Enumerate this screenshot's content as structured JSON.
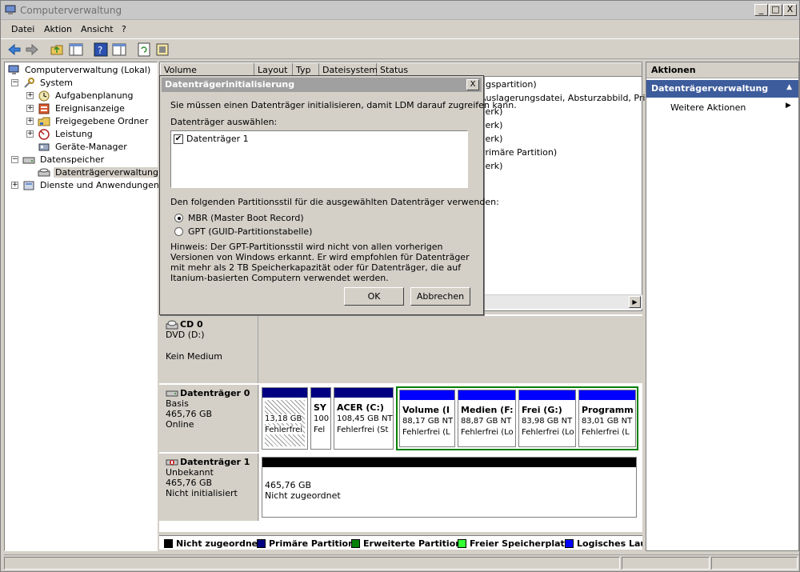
{
  "window": {
    "title": "Computerverwaltung",
    "controls": {
      "minimize": "_",
      "maximize": "□",
      "close": "X"
    }
  },
  "menu": {
    "file": "Datei",
    "action": "Aktion",
    "view": "Ansicht",
    "help": "?"
  },
  "tree": {
    "root": "Computerverwaltung (Lokal)",
    "system": "System",
    "tasks": "Aufgabenplanung",
    "events": "Ereignisanzeige",
    "shared": "Freigegebene Ordner",
    "perf": "Leistung",
    "devices": "Geräte-Manager",
    "storage": "Datenspeicher",
    "diskmgmt": "Datenträgerverwaltung",
    "services": "Dienste und Anwendungen"
  },
  "volumes": {
    "columns": [
      "Volume",
      "Layout",
      "Typ",
      "Dateisystem",
      "Status"
    ],
    "visible_rows": [
      "ngspartition)",
      "Auslagerungsdatei, Absturzabbild, Primäre",
      "verk)",
      "verk)",
      "verk)",
      "Primäre Partition)",
      "verk)"
    ]
  },
  "disks": {
    "cd0": {
      "name": "CD 0",
      "type": "DVD (D:)",
      "status": "Kein Medium"
    },
    "disk0": {
      "name": "Datenträger 0",
      "type": "Basis",
      "size": "465,76 GB",
      "status": "Online",
      "partitions": [
        {
          "title": "",
          "size": "13,18 GB",
          "status": "Fehlerfrei"
        },
        {
          "title": "SY",
          "size": "100",
          "status": "Fel"
        },
        {
          "title": "ACER (C:)",
          "size": "108,45 GB NT",
          "status": "Fehlerfrei (St"
        },
        {
          "title": "Volume (I",
          "size": "88,17 GB NT",
          "status": "Fehlerfrei (L"
        },
        {
          "title": "Medien (F:",
          "size": "88,87 GB NT",
          "status": "Fehlerfrei (Lo"
        },
        {
          "title": "Frei (G:)",
          "size": "83,98 GB NT",
          "status": "Fehlerfrei (Lo"
        },
        {
          "title": "Programm",
          "size": "83,01 GB NT",
          "status": "Fehlerfrei (L"
        }
      ]
    },
    "disk1": {
      "name": "Datenträger 1",
      "type": "Unbekannt",
      "size": "465,76 GB",
      "status": "Nicht initialisiert",
      "unallocated_size": "465,76 GB",
      "unallocated_label": "Nicht zugeordnet"
    }
  },
  "legend": [
    {
      "label": "Nicht zugeordnet",
      "color": "#000000"
    },
    {
      "label": "Primäre Partition",
      "color": "#000080"
    },
    {
      "label": "Erweiterte Partition",
      "color": "#008000"
    },
    {
      "label": "Freier Speicherplatz",
      "color": "#33ff33"
    },
    {
      "label": "Logisches Lauf",
      "color": "#0000ff"
    }
  ],
  "actions": {
    "header": "Aktionen",
    "section": "Datenträgerverwaltung",
    "more": "Weitere Aktionen"
  },
  "dialog": {
    "title": "Datenträgerinitialisierung",
    "close": "X",
    "intro": "Sie müssen einen Datenträger initialisieren, damit LDM darauf zugreifen kann.",
    "select_label": "Datenträger auswählen:",
    "disk_item": "Datenträger 1",
    "disk_checked": true,
    "style_label": "Den folgenden Partitionsstil für die ausgewählten Datenträger verwenden:",
    "mbr": "MBR (Master Boot Record)",
    "gpt": "GPT (GUID-Partitionstabelle)",
    "selected_style": "MBR",
    "hint": "Hinweis: Der GPT-Partitionsstil wird nicht von allen vorherigen Versionen von Windows erkannt. Er wird empfohlen für Datenträger mit mehr als 2 TB Speicherkapazität oder für Datenträger, die auf Itanium-basierten Computern verwendet werden.",
    "ok": "OK",
    "cancel": "Abbrechen"
  },
  "colors": {
    "accent": "#3d5c9c",
    "primary_bar": "#000080",
    "logical_bar": "#0000ff",
    "extended_frame": "#008000"
  }
}
